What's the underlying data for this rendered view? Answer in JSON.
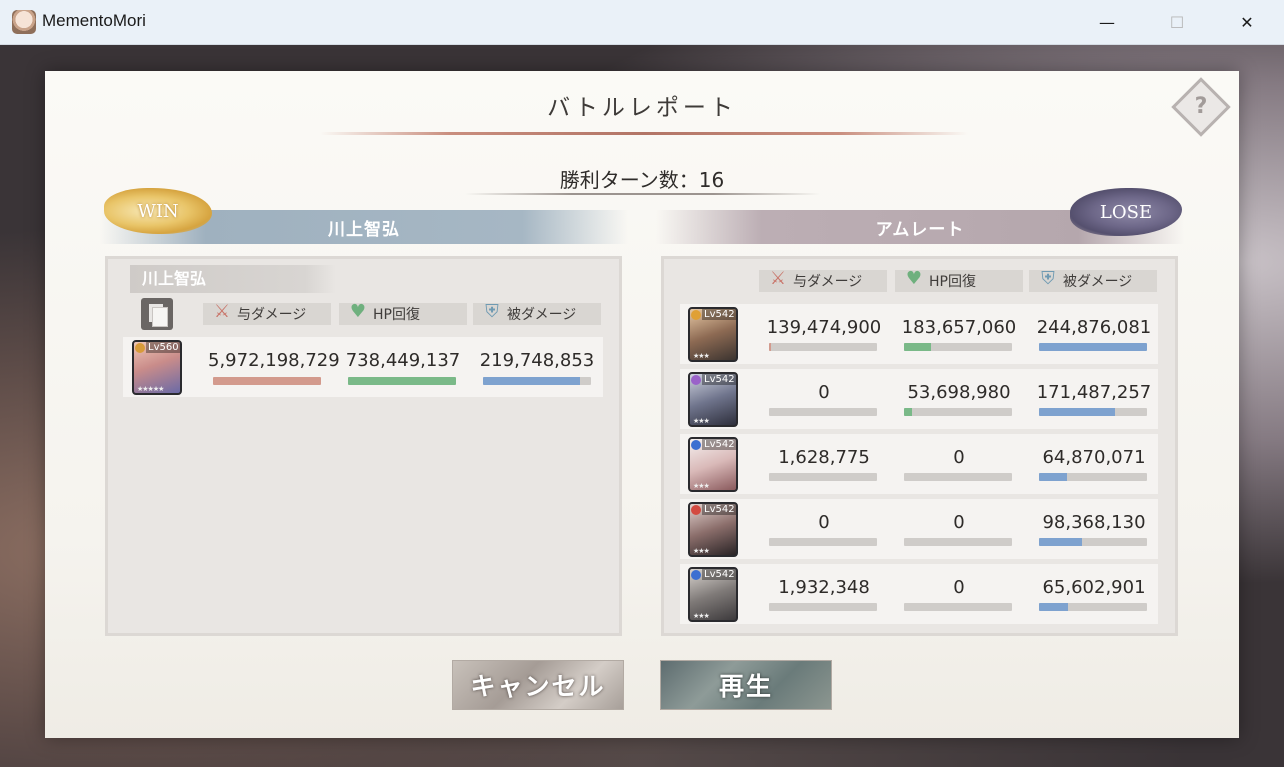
{
  "window": {
    "title": "MementoMori",
    "minimize": "—",
    "maximize": "☐",
    "close": "✕"
  },
  "report": {
    "title": "バトルレポート",
    "turns": "勝利ターン数：16",
    "help": "?"
  },
  "left_team": {
    "result": "WIN",
    "name": "川上智弘",
    "player_tag": "川上智弘",
    "headers": {
      "damage": "与ダメージ",
      "heal": "HP回復",
      "taken": "被ダメージ"
    },
    "rows": [
      {
        "level": "Lv560",
        "element_color": "#d89b3a",
        "stars": "★★★★★",
        "damage": "5,972,198,729",
        "heal": "738,449,137",
        "taken": "219,748,853",
        "damage_ratio": 1.0,
        "heal_ratio": 1.0,
        "taken_ratio": 0.9
      }
    ]
  },
  "right_team": {
    "result": "LOSE",
    "name": "アムレート",
    "headers": {
      "damage": "与ダメージ",
      "heal": "HP回復",
      "taken": "被ダメージ"
    },
    "rows": [
      {
        "level": "Lv542",
        "element_color": "#e0a035",
        "stars": "★★★",
        "damage": "139,474,900",
        "heal": "183,657,060",
        "taken": "244,876,081",
        "damage_ratio": 0.02,
        "heal_ratio": 0.25,
        "taken_ratio": 1.0
      },
      {
        "level": "Lv542",
        "element_color": "#9a62c9",
        "stars": "★★★",
        "damage": "0",
        "heal": "53,698,980",
        "taken": "171,487,257",
        "damage_ratio": 0.0,
        "heal_ratio": 0.07,
        "taken_ratio": 0.7
      },
      {
        "level": "Lv542",
        "element_color": "#3c6fd1",
        "stars": "★★★",
        "damage": "1,628,775",
        "heal": "0",
        "taken": "64,870,071",
        "damage_ratio": 0.0,
        "heal_ratio": 0.0,
        "taken_ratio": 0.26
      },
      {
        "level": "Lv542",
        "element_color": "#d34a40",
        "stars": "★★★",
        "damage": "0",
        "heal": "0",
        "taken": "98,368,130",
        "damage_ratio": 0.0,
        "heal_ratio": 0.0,
        "taken_ratio": 0.4
      },
      {
        "level": "Lv542",
        "element_color": "#3c6fd1",
        "stars": "★★★",
        "damage": "1,932,348",
        "heal": "0",
        "taken": "65,602,901",
        "damage_ratio": 0.0,
        "heal_ratio": 0.0,
        "taken_ratio": 0.27
      }
    ]
  },
  "buttons": {
    "cancel": "キャンセル",
    "play": "再生"
  },
  "icons": {
    "damage": "sword-icon",
    "heal": "heart-icon",
    "taken": "shield-icon"
  },
  "colors": {
    "damage_bar": "#d39a8d",
    "heal_bar": "#7ab988",
    "taken_bar": "#7ea2cf"
  }
}
